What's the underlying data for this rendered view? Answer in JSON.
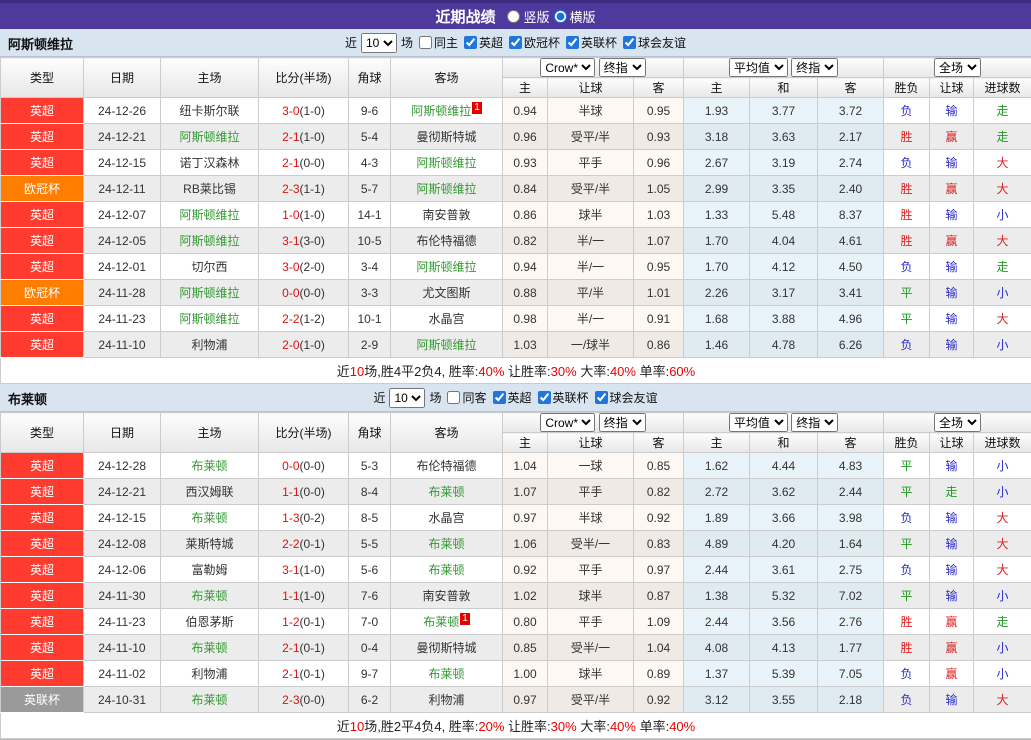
{
  "topbar": {
    "title": "近期战绩",
    "radios": [
      {
        "label": "竖版",
        "checked": false
      },
      {
        "label": "横版",
        "checked": true
      }
    ]
  },
  "table_template": {
    "main_headers": [
      "类型",
      "日期",
      "主场",
      "比分(半场)",
      "角球",
      "客场"
    ],
    "crow_group": {
      "select1": "Crow*",
      "select2": "终指",
      "sub": [
        "主",
        "让球",
        "客"
      ]
    },
    "avg_group": {
      "select1": "平均值",
      "select2": "终指",
      "sub": [
        "主",
        "和",
        "客"
      ]
    },
    "result_group": {
      "select1": "全场",
      "sub": [
        "胜负",
        "让球",
        "进球数"
      ]
    }
  },
  "colors": {
    "type_badges": {
      "英超": "#ff3b30",
      "欧冠杯": "#ff7e00",
      "英联杯": "#9a9a9a"
    },
    "results": {
      "胜": "red",
      "赢": "red",
      "大": "red",
      "负": "blue",
      "输": "blue",
      "小": "blue",
      "平": "green",
      "走": "green"
    }
  },
  "sections": [
    {
      "team": "阿斯顿维拉",
      "filters": {
        "recent_label": "近",
        "count": "10",
        "games_label": "场",
        "same_label": "同主",
        "same_checked": false,
        "leagues": [
          {
            "label": "英超",
            "checked": true
          },
          {
            "label": "欧冠杯",
            "checked": true
          },
          {
            "label": "英联杯",
            "checked": true
          },
          {
            "label": "球会友谊",
            "checked": true
          }
        ]
      },
      "rows": [
        {
          "type": "英超",
          "date": "24-12-26",
          "home": "纽卡斯尔联",
          "home_team": false,
          "score": "3-0",
          "half": "(1-0)",
          "corners": "9-6",
          "away": "阿斯顿维拉",
          "away_team": true,
          "away_badge": "1",
          "crow": [
            "0.94",
            "半球",
            "0.95"
          ],
          "avg": [
            "1.93",
            "3.77",
            "3.72"
          ],
          "results": [
            "负",
            "输",
            "走"
          ]
        },
        {
          "type": "英超",
          "date": "24-12-21",
          "home": "阿斯顿维拉",
          "home_team": true,
          "score": "2-1",
          "half": "(1-0)",
          "corners": "5-4",
          "away": "曼彻斯特城",
          "away_team": false,
          "crow": [
            "0.96",
            "受平/半",
            "0.93"
          ],
          "avg": [
            "3.18",
            "3.63",
            "2.17"
          ],
          "results": [
            "胜",
            "赢",
            "走"
          ]
        },
        {
          "type": "英超",
          "date": "24-12-15",
          "home": "诺丁汉森林",
          "home_team": false,
          "score": "2-1",
          "half": "(0-0)",
          "corners": "4-3",
          "away": "阿斯顿维拉",
          "away_team": true,
          "crow": [
            "0.93",
            "平手",
            "0.96"
          ],
          "avg": [
            "2.67",
            "3.19",
            "2.74"
          ],
          "results": [
            "负",
            "输",
            "大"
          ]
        },
        {
          "type": "欧冠杯",
          "date": "24-12-11",
          "home": "RB莱比锡",
          "home_team": false,
          "score": "2-3",
          "half": "(1-1)",
          "corners": "5-7",
          "away": "阿斯顿维拉",
          "away_team": true,
          "crow": [
            "0.84",
            "受平/半",
            "1.05"
          ],
          "avg": [
            "2.99",
            "3.35",
            "2.40"
          ],
          "results": [
            "胜",
            "赢",
            "大"
          ]
        },
        {
          "type": "英超",
          "date": "24-12-07",
          "home": "阿斯顿维拉",
          "home_team": true,
          "score": "1-0",
          "half": "(1-0)",
          "corners": "14-1",
          "away": "南安普敦",
          "away_team": false,
          "crow": [
            "0.86",
            "球半",
            "1.03"
          ],
          "avg": [
            "1.33",
            "5.48",
            "8.37"
          ],
          "results": [
            "胜",
            "输",
            "小"
          ]
        },
        {
          "type": "英超",
          "date": "24-12-05",
          "home": "阿斯顿维拉",
          "home_team": true,
          "score": "3-1",
          "half": "(3-0)",
          "corners": "10-5",
          "away": "布伦特福德",
          "away_team": false,
          "crow": [
            "0.82",
            "半/一",
            "1.07"
          ],
          "avg": [
            "1.70",
            "4.04",
            "4.61"
          ],
          "results": [
            "胜",
            "赢",
            "大"
          ]
        },
        {
          "type": "英超",
          "date": "24-12-01",
          "home": "切尔西",
          "home_team": false,
          "score": "3-0",
          "half": "(2-0)",
          "corners": "3-4",
          "away": "阿斯顿维拉",
          "away_team": true,
          "crow": [
            "0.94",
            "半/一",
            "0.95"
          ],
          "avg": [
            "1.70",
            "4.12",
            "4.50"
          ],
          "results": [
            "负",
            "输",
            "走"
          ]
        },
        {
          "type": "欧冠杯",
          "date": "24-11-28",
          "home": "阿斯顿维拉",
          "home_team": true,
          "score": "0-0",
          "half": "(0-0)",
          "corners": "3-3",
          "away": "尤文图斯",
          "away_team": false,
          "crow": [
            "0.88",
            "平/半",
            "1.01"
          ],
          "avg": [
            "2.26",
            "3.17",
            "3.41"
          ],
          "results": [
            "平",
            "输",
            "小"
          ]
        },
        {
          "type": "英超",
          "date": "24-11-23",
          "home": "阿斯顿维拉",
          "home_team": true,
          "score": "2-2",
          "half": "(1-2)",
          "corners": "10-1",
          "away": "水晶宫",
          "away_team": false,
          "crow": [
            "0.98",
            "半/一",
            "0.91"
          ],
          "avg": [
            "1.68",
            "3.88",
            "4.96"
          ],
          "results": [
            "平",
            "输",
            "大"
          ]
        },
        {
          "type": "英超",
          "date": "24-11-10",
          "home": "利物浦",
          "home_team": false,
          "score": "2-0",
          "half": "(1-0)",
          "corners": "2-9",
          "away": "阿斯顿维拉",
          "away_team": true,
          "crow": [
            "1.03",
            "一/球半",
            "0.86"
          ],
          "avg": [
            "1.46",
            "4.78",
            "6.26"
          ],
          "results": [
            "负",
            "输",
            "小"
          ]
        }
      ],
      "summary": [
        {
          "text": "近",
          "red": false
        },
        {
          "text": "10",
          "red": true
        },
        {
          "text": "场,胜4平2负4, 胜率:",
          "red": false
        },
        {
          "text": "40%",
          "red": true
        },
        {
          "text": " 让胜率:",
          "red": false
        },
        {
          "text": "30%",
          "red": true
        },
        {
          "text": " 大率:",
          "red": false
        },
        {
          "text": "40%",
          "red": true
        },
        {
          "text": " 单率:",
          "red": false
        },
        {
          "text": "60%",
          "red": true
        }
      ]
    },
    {
      "team": "布莱顿",
      "filters": {
        "recent_label": "近",
        "count": "10",
        "games_label": "场",
        "same_label": "同客",
        "same_checked": false,
        "leagues": [
          {
            "label": "英超",
            "checked": true
          },
          {
            "label": "英联杯",
            "checked": true
          },
          {
            "label": "球会友谊",
            "checked": true
          }
        ]
      },
      "rows": [
        {
          "type": "英超",
          "date": "24-12-28",
          "home": "布莱顿",
          "home_team": true,
          "score": "0-0",
          "half": "(0-0)",
          "corners": "5-3",
          "away": "布伦特福德",
          "away_team": false,
          "crow": [
            "1.04",
            "一球",
            "0.85"
          ],
          "avg": [
            "1.62",
            "4.44",
            "4.83"
          ],
          "results": [
            "平",
            "输",
            "小"
          ]
        },
        {
          "type": "英超",
          "date": "24-12-21",
          "home": "西汉姆联",
          "home_team": false,
          "score": "1-1",
          "half": "(0-0)",
          "corners": "8-4",
          "away": "布莱顿",
          "away_team": true,
          "crow": [
            "1.07",
            "平手",
            "0.82"
          ],
          "avg": [
            "2.72",
            "3.62",
            "2.44"
          ],
          "results": [
            "平",
            "走",
            "小"
          ]
        },
        {
          "type": "英超",
          "date": "24-12-15",
          "home": "布莱顿",
          "home_team": true,
          "score": "1-3",
          "half": "(0-2)",
          "corners": "8-5",
          "away": "水晶宫",
          "away_team": false,
          "crow": [
            "0.97",
            "半球",
            "0.92"
          ],
          "avg": [
            "1.89",
            "3.66",
            "3.98"
          ],
          "results": [
            "负",
            "输",
            "大"
          ]
        },
        {
          "type": "英超",
          "date": "24-12-08",
          "home": "莱斯特城",
          "home_team": false,
          "score": "2-2",
          "half": "(0-1)",
          "corners": "5-5",
          "away": "布莱顿",
          "away_team": true,
          "crow": [
            "1.06",
            "受半/一",
            "0.83"
          ],
          "avg": [
            "4.89",
            "4.20",
            "1.64"
          ],
          "results": [
            "平",
            "输",
            "大"
          ]
        },
        {
          "type": "英超",
          "date": "24-12-06",
          "home": "富勒姆",
          "home_team": false,
          "score": "3-1",
          "half": "(1-0)",
          "corners": "5-6",
          "away": "布莱顿",
          "away_team": true,
          "crow": [
            "0.92",
            "平手",
            "0.97"
          ],
          "avg": [
            "2.44",
            "3.61",
            "2.75"
          ],
          "results": [
            "负",
            "输",
            "大"
          ]
        },
        {
          "type": "英超",
          "date": "24-11-30",
          "home": "布莱顿",
          "home_team": true,
          "score": "1-1",
          "half": "(1-0)",
          "corners": "7-6",
          "away": "南安普敦",
          "away_team": false,
          "crow": [
            "1.02",
            "球半",
            "0.87"
          ],
          "avg": [
            "1.38",
            "5.32",
            "7.02"
          ],
          "results": [
            "平",
            "输",
            "小"
          ]
        },
        {
          "type": "英超",
          "date": "24-11-23",
          "home": "伯恩茅斯",
          "home_team": false,
          "score": "1-2",
          "half": "(0-1)",
          "corners": "7-0",
          "away": "布莱顿",
          "away_team": true,
          "away_badge": "1",
          "crow": [
            "0.80",
            "平手",
            "1.09"
          ],
          "avg": [
            "2.44",
            "3.56",
            "2.76"
          ],
          "results": [
            "胜",
            "赢",
            "走"
          ]
        },
        {
          "type": "英超",
          "date": "24-11-10",
          "home": "布莱顿",
          "home_team": true,
          "score": "2-1",
          "half": "(0-1)",
          "corners": "0-4",
          "away": "曼彻斯特城",
          "away_team": false,
          "crow": [
            "0.85",
            "受半/一",
            "1.04"
          ],
          "avg": [
            "4.08",
            "4.13",
            "1.77"
          ],
          "results": [
            "胜",
            "赢",
            "小"
          ]
        },
        {
          "type": "英超",
          "date": "24-11-02",
          "home": "利物浦",
          "home_team": false,
          "score": "2-1",
          "half": "(0-1)",
          "corners": "9-7",
          "away": "布莱顿",
          "away_team": true,
          "crow": [
            "1.00",
            "球半",
            "0.89"
          ],
          "avg": [
            "1.37",
            "5.39",
            "7.05"
          ],
          "results": [
            "负",
            "赢",
            "小"
          ]
        },
        {
          "type": "英联杯",
          "date": "24-10-31",
          "home": "布莱顿",
          "home_team": true,
          "score": "2-3",
          "half": "(0-0)",
          "corners": "6-2",
          "away": "利物浦",
          "away_team": false,
          "crow": [
            "0.97",
            "受平/半",
            "0.92"
          ],
          "avg": [
            "3.12",
            "3.55",
            "2.18"
          ],
          "results": [
            "负",
            "输",
            "大"
          ]
        }
      ],
      "summary": [
        {
          "text": "近",
          "red": false
        },
        {
          "text": "10",
          "red": true
        },
        {
          "text": "场,胜2平4负4, 胜率:",
          "red": false
        },
        {
          "text": "20%",
          "red": true
        },
        {
          "text": " 让胜率:",
          "red": false
        },
        {
          "text": "30%",
          "red": true
        },
        {
          "text": " 大率:",
          "red": false
        },
        {
          "text": "40%",
          "red": true
        },
        {
          "text": " 单率:",
          "red": false
        },
        {
          "text": "40%",
          "red": true
        }
      ]
    }
  ]
}
